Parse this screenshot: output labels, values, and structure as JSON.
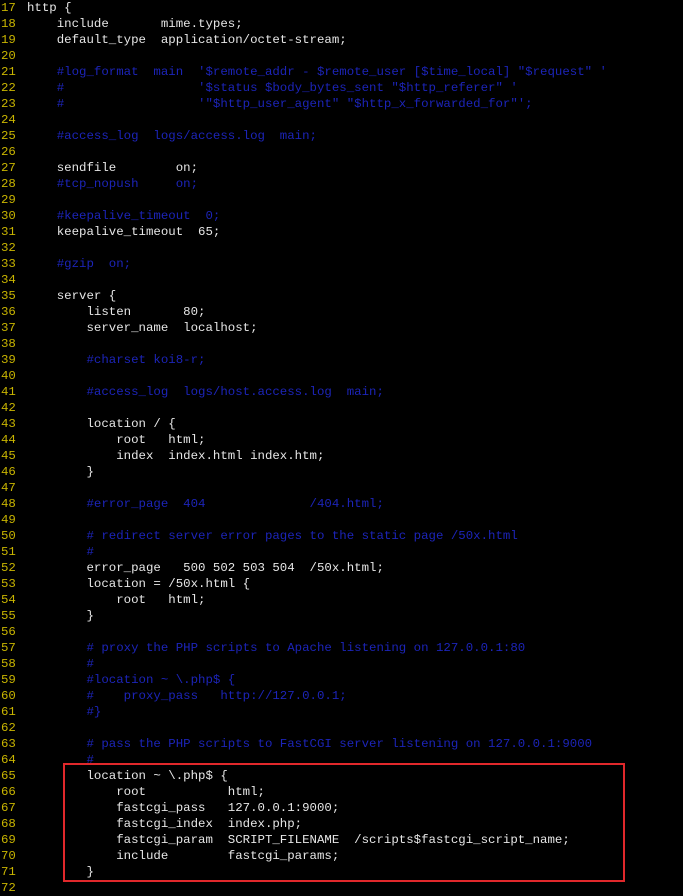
{
  "colors": {
    "background": "#000000",
    "line_number": "#c8b400",
    "text": "#e6e6e6",
    "comment": "#1c24b8",
    "highlight_border": "#e0282b"
  },
  "lines": [
    {
      "num": "17",
      "text": "http {",
      "type": "plain"
    },
    {
      "num": "18",
      "text": "    include       mime.types;",
      "type": "plain"
    },
    {
      "num": "19",
      "text": "    default_type  application/octet-stream;",
      "type": "plain"
    },
    {
      "num": "20",
      "text": "",
      "type": "plain"
    },
    {
      "num": "21",
      "text": "    #log_format  main  '$remote_addr - $remote_user [$time_local] \"$request\" '",
      "type": "comment"
    },
    {
      "num": "22",
      "text": "    #                  '$status $body_bytes_sent \"$http_referer\" '",
      "type": "comment"
    },
    {
      "num": "23",
      "text": "    #                  '\"$http_user_agent\" \"$http_x_forwarded_for\"';",
      "type": "comment"
    },
    {
      "num": "24",
      "text": "",
      "type": "plain"
    },
    {
      "num": "25",
      "text": "    #access_log  logs/access.log  main;",
      "type": "comment"
    },
    {
      "num": "26",
      "text": "",
      "type": "plain"
    },
    {
      "num": "27",
      "text": "    sendfile        on;",
      "type": "plain"
    },
    {
      "num": "28",
      "text": "    #tcp_nopush     on;",
      "type": "comment"
    },
    {
      "num": "29",
      "text": "",
      "type": "plain"
    },
    {
      "num": "30",
      "text": "    #keepalive_timeout  0;",
      "type": "comment"
    },
    {
      "num": "31",
      "text": "    keepalive_timeout  65;",
      "type": "plain"
    },
    {
      "num": "32",
      "text": "",
      "type": "plain"
    },
    {
      "num": "33",
      "text": "    #gzip  on;",
      "type": "comment"
    },
    {
      "num": "34",
      "text": "",
      "type": "plain"
    },
    {
      "num": "35",
      "text": "    server {",
      "type": "plain"
    },
    {
      "num": "36",
      "text": "        listen       80;",
      "type": "plain"
    },
    {
      "num": "37",
      "text": "        server_name  localhost;",
      "type": "plain"
    },
    {
      "num": "38",
      "text": "",
      "type": "plain"
    },
    {
      "num": "39",
      "text": "        #charset koi8-r;",
      "type": "comment"
    },
    {
      "num": "40",
      "text": "",
      "type": "plain"
    },
    {
      "num": "41",
      "text": "        #access_log  logs/host.access.log  main;",
      "type": "comment"
    },
    {
      "num": "42",
      "text": "",
      "type": "plain"
    },
    {
      "num": "43",
      "text": "        location / {",
      "type": "plain"
    },
    {
      "num": "44",
      "text": "            root   html;",
      "type": "plain"
    },
    {
      "num": "45",
      "text": "            index  index.html index.htm;",
      "type": "plain"
    },
    {
      "num": "46",
      "text": "        }",
      "type": "plain"
    },
    {
      "num": "47",
      "text": "",
      "type": "plain"
    },
    {
      "num": "48",
      "text": "        #error_page  404              /404.html;",
      "type": "comment"
    },
    {
      "num": "49",
      "text": "",
      "type": "plain"
    },
    {
      "num": "50",
      "text": "        # redirect server error pages to the static page /50x.html",
      "type": "comment"
    },
    {
      "num": "51",
      "text": "        #",
      "type": "comment"
    },
    {
      "num": "52",
      "text": "        error_page   500 502 503 504  /50x.html;",
      "type": "plain"
    },
    {
      "num": "53",
      "text": "        location = /50x.html {",
      "type": "plain"
    },
    {
      "num": "54",
      "text": "            root   html;",
      "type": "plain"
    },
    {
      "num": "55",
      "text": "        }",
      "type": "plain"
    },
    {
      "num": "56",
      "text": "",
      "type": "plain"
    },
    {
      "num": "57",
      "text": "        # proxy the PHP scripts to Apache listening on 127.0.0.1:80",
      "type": "comment"
    },
    {
      "num": "58",
      "text": "        #",
      "type": "comment"
    },
    {
      "num": "59",
      "text": "        #location ~ \\.php$ {",
      "type": "comment"
    },
    {
      "num": "60",
      "text": "        #    proxy_pass   http://127.0.0.1;",
      "type": "comment"
    },
    {
      "num": "61",
      "text": "        #}",
      "type": "comment"
    },
    {
      "num": "62",
      "text": "",
      "type": "plain"
    },
    {
      "num": "63",
      "text": "        # pass the PHP scripts to FastCGI server listening on 127.0.0.1:9000",
      "type": "comment"
    },
    {
      "num": "64",
      "text": "        #",
      "type": "comment"
    },
    {
      "num": "65",
      "text": "        location ~ \\.php$ {",
      "type": "plain"
    },
    {
      "num": "66",
      "text": "            root           html;",
      "type": "plain"
    },
    {
      "num": "67",
      "text": "            fastcgi_pass   127.0.0.1:9000;",
      "type": "plain"
    },
    {
      "num": "68",
      "text": "            fastcgi_index  index.php;",
      "type": "plain"
    },
    {
      "num": "69",
      "text": "            fastcgi_param  SCRIPT_FILENAME  /scripts$fastcgi_script_name;",
      "type": "plain"
    },
    {
      "num": "70",
      "text": "            include        fastcgi_params;",
      "type": "plain"
    },
    {
      "num": "71",
      "text": "        }",
      "type": "plain"
    },
    {
      "num": "72",
      "text": "",
      "type": "plain"
    }
  ]
}
